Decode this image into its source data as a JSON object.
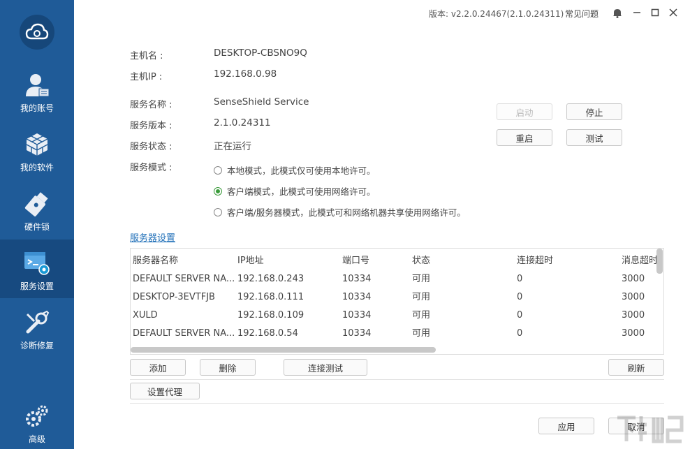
{
  "sidebar": {
    "items": [
      {
        "label": "我的账号",
        "icon": "user-icon"
      },
      {
        "label": "我的软件",
        "icon": "cube-icon"
      },
      {
        "label": "硬件锁",
        "icon": "usb-key-icon"
      },
      {
        "label": "服务设置",
        "icon": "service-settings-icon"
      },
      {
        "label": "诊断修复",
        "icon": "wrench-icon"
      },
      {
        "label": "高级",
        "icon": "gears-icon"
      }
    ]
  },
  "titlebar": {
    "version": "版本: v2.2.0.24467(2.1.0.24311)",
    "faq": "常见问题"
  },
  "info": {
    "hostname_label": "主机名 :",
    "hostname_value": "DESKTOP-CBSNO9Q",
    "hostip_label": "主机IP :",
    "hostip_value": "192.168.0.98",
    "service_name_label": "服务名称 :",
    "service_name_value": "SenseShield Service",
    "service_version_label": "服务版本 :",
    "service_version_value": "2.1.0.24311",
    "service_status_label": "服务状态 :",
    "service_status_value": "正在运行",
    "service_mode_label": "服务模式 :"
  },
  "service_buttons": {
    "start": "启动",
    "stop": "停止",
    "restart": "重启",
    "test": "测试"
  },
  "modes": [
    {
      "label": "本地模式，此模式仅可使用本地许可。",
      "checked": false
    },
    {
      "label": "客户端模式，此模式可使用网络许可。",
      "checked": true
    },
    {
      "label": "客户端/服务器模式，此模式可和网络机器共享使用网络许可。",
      "checked": false
    }
  ],
  "server_settings_link": "服务器设置",
  "table": {
    "columns": [
      "服务器名称",
      "IP地址",
      "端口号",
      "状态",
      "连接超时",
      "消息超时"
    ],
    "rows": [
      [
        "DEFAULT SERVER NA...",
        "192.168.0.243",
        "10334",
        "可用",
        "0",
        "3000"
      ],
      [
        "DESKTOP-3EVTFJB",
        "192.168.0.111",
        "10334",
        "可用",
        "0",
        "3000"
      ],
      [
        "XULD",
        "192.168.0.109",
        "10334",
        "可用",
        "0",
        "3000"
      ],
      [
        "DEFAULT SERVER NA...",
        "192.168.0.54",
        "10334",
        "可用",
        "0",
        "3000"
      ]
    ]
  },
  "table_buttons": {
    "add": "添加",
    "delete": "删除",
    "connect_test": "连接测试",
    "refresh": "刷新",
    "proxy": "设置代理"
  },
  "footer": {
    "apply": "应用",
    "cancel": "取消"
  },
  "colors": {
    "sidebar": "#1f5b98",
    "sidebar_active": "#174a80",
    "accent_link": "#1f6fb8",
    "radio_checked": "#3a9b3a"
  }
}
